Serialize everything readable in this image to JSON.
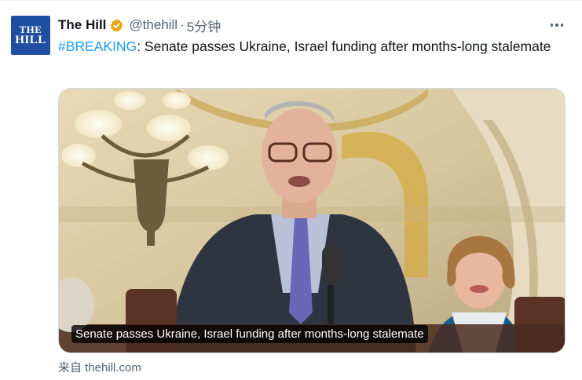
{
  "account": {
    "avatar_line1": "THE",
    "avatar_line2": "HILL",
    "name": "The Hill",
    "handle": "@thehill",
    "separator": "·",
    "time": "5分钟"
  },
  "tweet": {
    "hashtag": "#BREAKING",
    "text": ": Senate passes Ukraine, Israel funding after months-long stalemate"
  },
  "card": {
    "caption": "Senate passes Ukraine, Israel funding after months-long stalemate",
    "source": "来自 thehill.com"
  },
  "icons": {
    "verified": "verified-badge-icon",
    "more": "more-options-icon"
  },
  "colors": {
    "link": "#1d9bf0",
    "verified_badge": "#e8a80c",
    "secondary_text": "#536471",
    "avatar_bg": "#1f4fa0"
  }
}
